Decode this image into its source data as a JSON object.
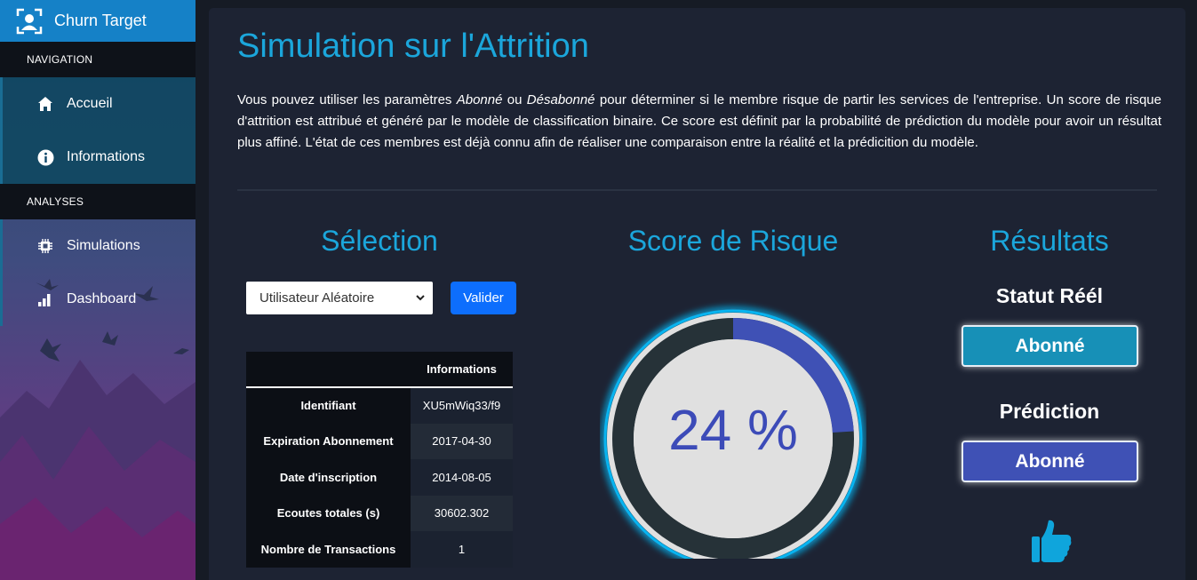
{
  "app": {
    "title": "Churn Target"
  },
  "sidebar": {
    "sections": [
      {
        "label": "NAVIGATION"
      },
      {
        "label": "ANALYSES"
      }
    ],
    "items": [
      {
        "label": "Accueil",
        "icon": "home-icon"
      },
      {
        "label": "Informations",
        "icon": "info-icon"
      },
      {
        "label": "Simulations",
        "icon": "chip-icon"
      },
      {
        "label": "Dashboard",
        "icon": "bar-chart-icon"
      }
    ]
  },
  "main": {
    "title": "Simulation sur l'Attrition",
    "intro": {
      "p1": "Vous pouvez utiliser les paramètres ",
      "abonne": "Abonné",
      "ou": " ou ",
      "desabonne": "Désabonné",
      "p2": " pour déterminer si le membre risque de partir les services de l'entreprise. Un score de risque d'attrition est attribué et généré par le modèle de classification binaire. Ce score est définit par la probabilité de prédiction du modèle pour avoir un résultat plus affiné. L'état de ces membres est déjà connu afin de réaliser une comparaison entre la réalité et la prédicition du modèle."
    },
    "selection": {
      "title": "Sélection",
      "select_value": "Utilisateur Aléatoire",
      "validate_label": "Valider",
      "table_header": "Informations",
      "rows": [
        {
          "key": "Identifiant",
          "value": "XU5mWiq33/f9"
        },
        {
          "key": "Expiration Abonnement",
          "value": "2017-04-30"
        },
        {
          "key": "Date d'inscription",
          "value": "2014-08-05"
        },
        {
          "key": "Ecoutes totales (s)",
          "value": "30602.302"
        },
        {
          "key": "Nombre de Transactions",
          "value": "1"
        }
      ]
    },
    "score": {
      "title": "Score de Risque",
      "value_text": "24 %",
      "fraction": 0.24,
      "colors": {
        "fill": "#3f51b5",
        "track": "#263238",
        "glow": "#08b4f0"
      }
    },
    "results": {
      "title": "Résultats",
      "real_label": "Statut Réél",
      "real_value": "Abonné",
      "real_color": "#1790b7",
      "prediction_label": "Prédiction",
      "prediction_value": "Abonné",
      "prediction_color": "#3f51b5",
      "icon": "thumbs-up-icon"
    }
  }
}
